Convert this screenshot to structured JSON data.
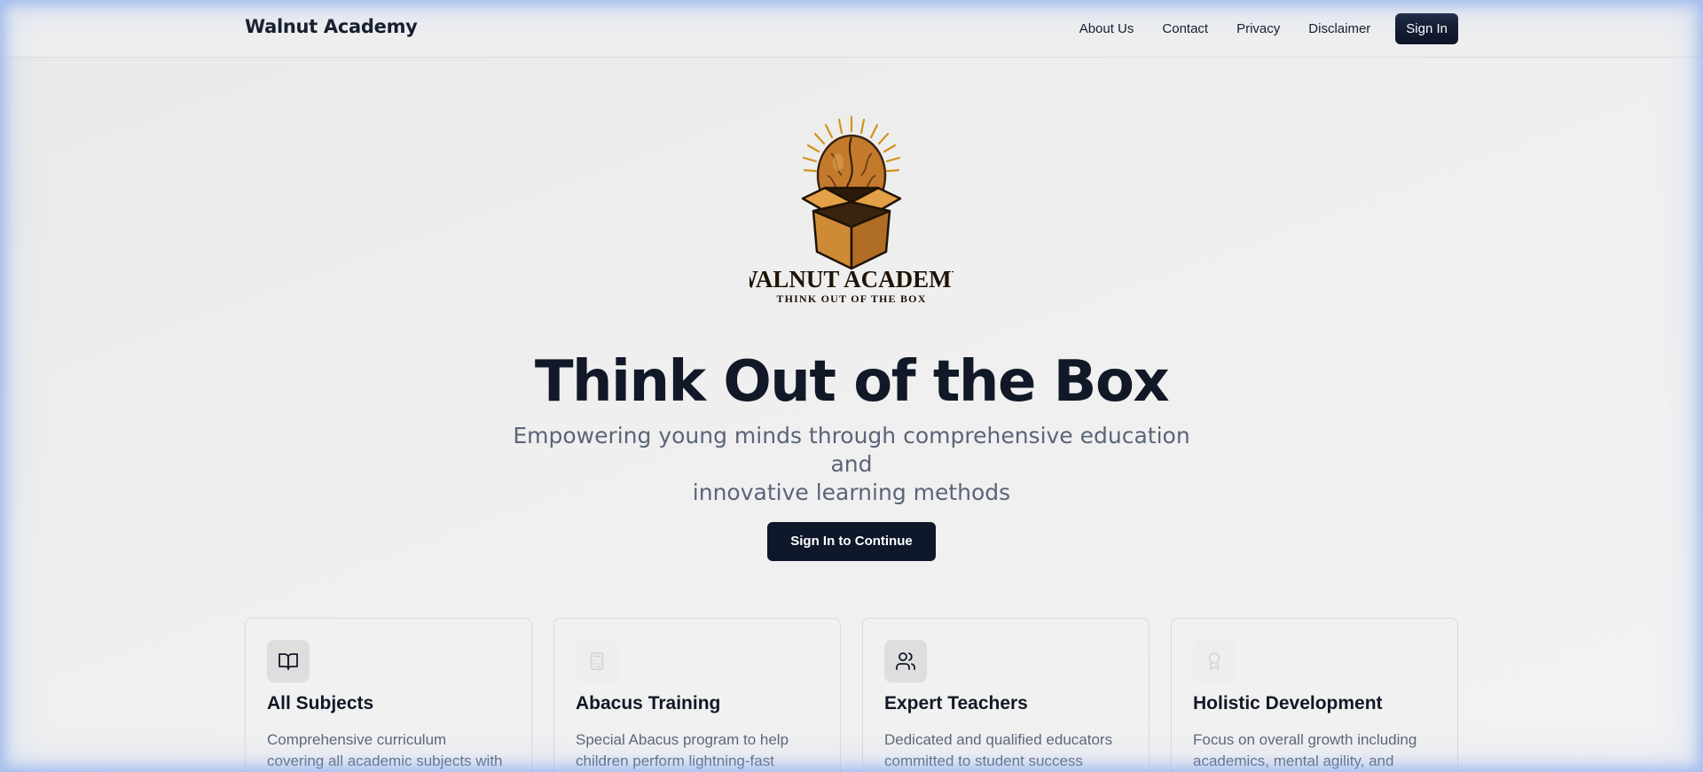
{
  "header": {
    "brand": "Walnut Academy",
    "nav": {
      "about": "About Us",
      "contact": "Contact",
      "privacy": "Privacy",
      "disclaimer": "Disclaimer"
    },
    "signin_label": "Sign In"
  },
  "logo": {
    "name": "WALNUT ACADEMY",
    "tagline": "THINK OUT OF THE BOX"
  },
  "hero": {
    "title": "Think Out of the Box",
    "subtitle_line1": "Empowering young minds through comprehensive education and",
    "subtitle_line2": "innovative learning methods",
    "cta_label": "Sign In to Continue"
  },
  "features": [
    {
      "icon": "book-open-icon",
      "title": "All Subjects",
      "desc_line1": "Comprehensive curriculum",
      "desc_line2": "covering all academic subjects with"
    },
    {
      "icon": "calculator-icon",
      "title": "Abacus Training",
      "desc_line1": "Special Abacus program to help",
      "desc_line2": "children perform lightning-fast"
    },
    {
      "icon": "users-icon",
      "title": "Expert Teachers",
      "desc_line1": "Dedicated and qualified educators",
      "desc_line2": "committed to student success"
    },
    {
      "icon": "award-icon",
      "title": "Holistic Development",
      "desc_line1": "Focus on overall growth including",
      "desc_line2": "academics, mental agility, and"
    }
  ],
  "colors": {
    "primary_dark": "#0f172a",
    "text_muted": "#5b6478",
    "logo_gold": "#d4921f",
    "logo_brown": "#8a4f1e"
  }
}
